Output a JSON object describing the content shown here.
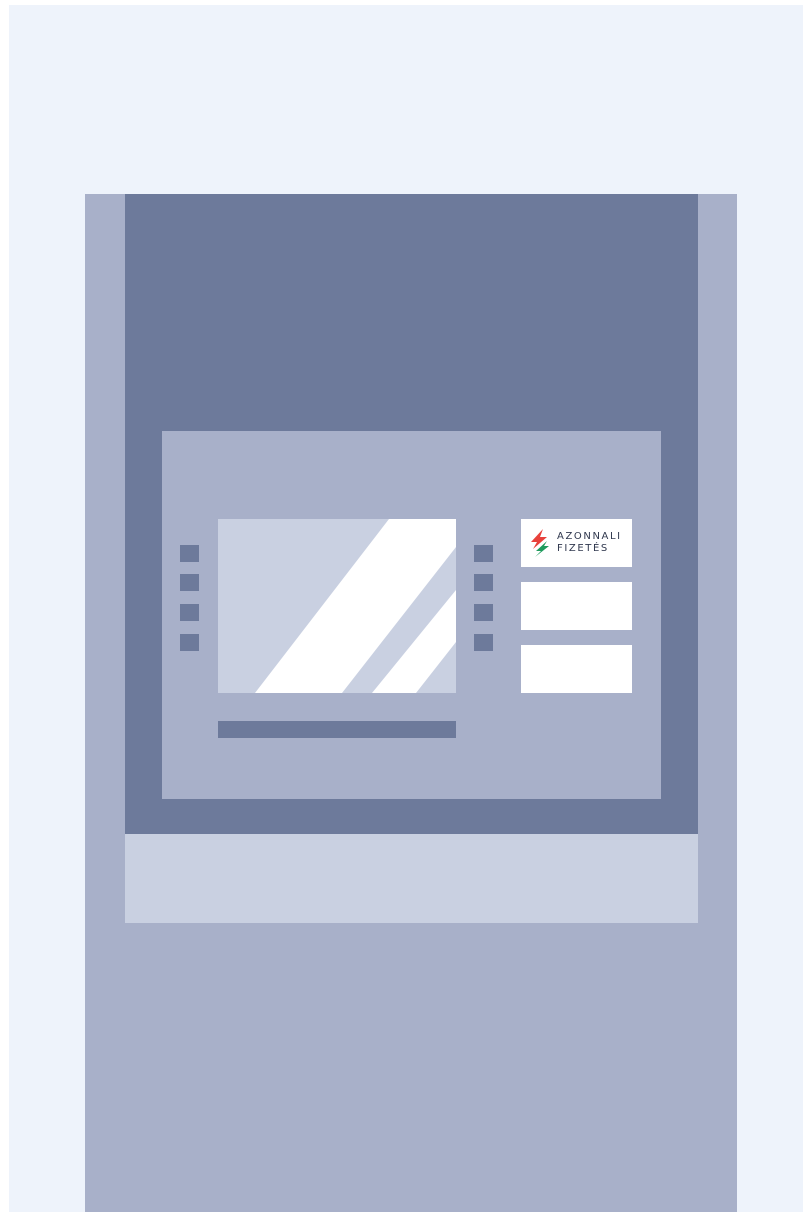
{
  "illustration": {
    "subject": "atm-machine",
    "colors": {
      "background": "#eef3fb",
      "body": "#a8b0c9",
      "panel": "#6d7a9b",
      "slot_band": "#c9d0e1",
      "screen": "#c9d0e1",
      "screen_glare": "#ffffff",
      "sticker": "#ffffff"
    }
  },
  "sticker_logo": {
    "line1": "AZONNALI",
    "line2": "FIZETÉS",
    "colors": {
      "bolt_top": "#e8413b",
      "bolt_bottom": "#1e9b5c",
      "text": "#30384e"
    },
    "icon": "lightning-bolt-icon"
  },
  "side_keys": {
    "left_count": 4,
    "right_count": 4
  },
  "side_panels": {
    "count": 3
  }
}
